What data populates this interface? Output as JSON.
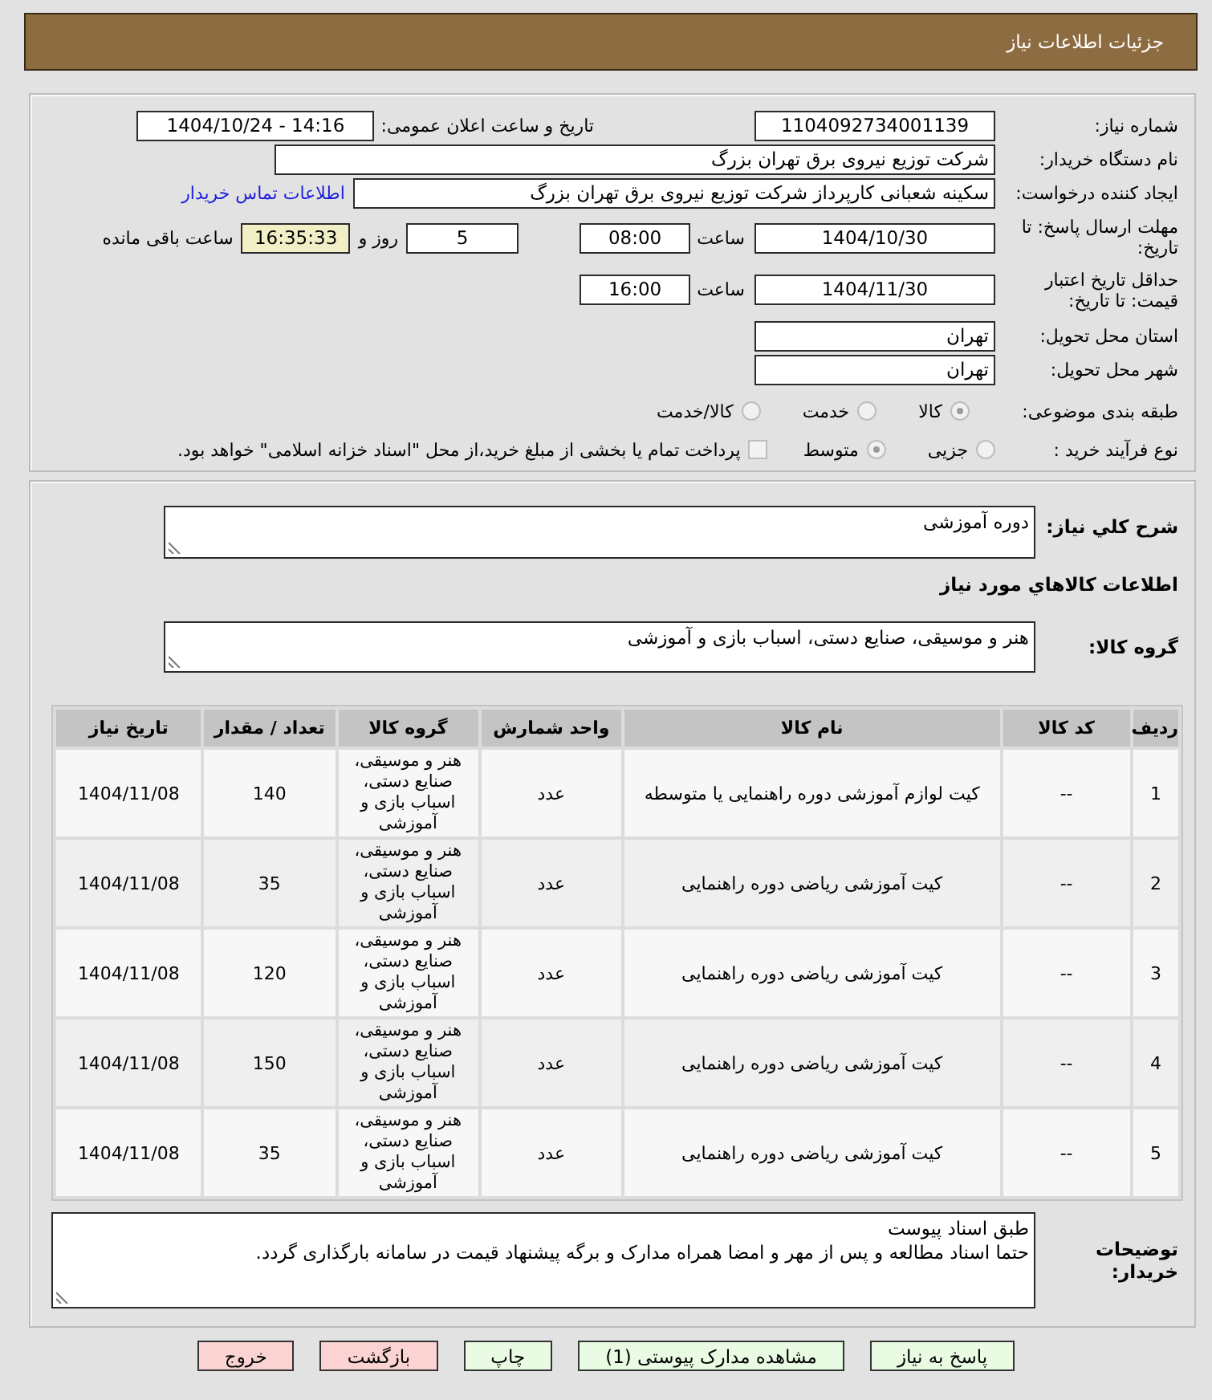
{
  "header": {
    "title": "جزئیات اطلاعات نیاز"
  },
  "details": {
    "need_number": {
      "label": "شماره نیاز:",
      "value": "1104092734001139"
    },
    "announce": {
      "label": "تاریخ و ساعت اعلان عمومی:",
      "value": "1404/10/24 - 14:16"
    },
    "buyer": {
      "label": "نام دستگاه خریدار:",
      "value": "شرکت توزیع نیروی برق تهران بزرگ"
    },
    "creator": {
      "label": "ایجاد کننده درخواست:",
      "value": "سکینه شعبانی کارپرداز شرکت توزیع نیروی برق تهران بزرگ",
      "link": "اطلاعات تماس خریدار"
    },
    "response_deadline": {
      "label": "مهلت ارسال پاسخ: تا تاریخ:",
      "date": "1404/10/30",
      "time_label": "ساعت",
      "time": "08:00",
      "days": "5",
      "days_label": "روز و",
      "remaining": "16:35:33",
      "remaining_label": "ساعت باقی مانده"
    },
    "price_validity": {
      "label": "حداقل تاریخ اعتبار قیمت: تا تاریخ:",
      "date": "1404/11/30",
      "time_label": "ساعت",
      "time": "16:00"
    },
    "province": {
      "label": "استان محل تحویل:",
      "value": "تهران"
    },
    "city": {
      "label": "شهر محل تحویل:",
      "value": "تهران"
    },
    "category": {
      "label": "طبقه بندی موضوعی:",
      "options": [
        {
          "label": "کالا",
          "selected": true
        },
        {
          "label": "خدمت",
          "selected": false
        },
        {
          "label": "کالا/خدمت",
          "selected": false
        }
      ]
    },
    "process": {
      "label": "نوع فرآیند خرید :",
      "options": [
        {
          "label": "جزیی",
          "selected": false
        },
        {
          "label": "متوسط",
          "selected": true
        }
      ],
      "treasury": {
        "label": "پرداخت تمام یا بخشی از مبلغ خرید،از محل \"اسناد خزانه اسلامی\" خواهد بود.",
        "checked": false
      }
    }
  },
  "description": {
    "label": "شرح کلي نیاز:",
    "value": "دوره آموزشی"
  },
  "goods_heading": "اطلاعات کالاهاي مورد نیاز",
  "goods_group": {
    "label": "گروه کالا:",
    "value": "هنر و موسیقی، صنایع دستی، اسباب بازی و آموزشی"
  },
  "table": {
    "columns": [
      "ردیف",
      "کد کالا",
      "نام کالا",
      "واحد شمارش",
      "گروه کالا",
      "تعداد / مقدار",
      "تاریخ نیاز"
    ],
    "rows": [
      [
        "1",
        "--",
        "کیت لوازم آموزشی دوره راهنمایی یا متوسطه",
        "عدد",
        "هنر و موسیقی، صنایع دستی، اسباب بازی و آموزشی",
        "140",
        "1404/11/08"
      ],
      [
        "2",
        "--",
        "کیت آموزشی ریاضی دوره راهنمایی",
        "عدد",
        "هنر و موسیقی، صنایع دستی، اسباب بازی و آموزشی",
        "35",
        "1404/11/08"
      ],
      [
        "3",
        "--",
        "کیت آموزشی ریاضی دوره راهنمایی",
        "عدد",
        "هنر و موسیقی، صنایع دستی، اسباب بازی و آموزشی",
        "120",
        "1404/11/08"
      ],
      [
        "4",
        "--",
        "کیت آموزشی ریاضی دوره راهنمایی",
        "عدد",
        "هنر و موسیقی، صنایع دستی، اسباب بازی و آموزشی",
        "150",
        "1404/11/08"
      ],
      [
        "5",
        "--",
        "کیت آموزشی ریاضی دوره راهنمایی",
        "عدد",
        "هنر و موسیقی، صنایع دستی، اسباب بازی و آموزشی",
        "35",
        "1404/11/08"
      ]
    ]
  },
  "buyer_notes": {
    "label": "توضیحات خریدار:",
    "lines": [
      "طبق اسناد پیوست",
      "حتما اسناد مطالعه و پس از مهر و امضا همراه مدارک و برگه پیشنهاد قیمت در سامانه بارگذاری گردد."
    ]
  },
  "buttons": [
    {
      "label": "پاسخ به نیاز",
      "kind": "action"
    },
    {
      "label": "مشاهده مدارک پیوستی (1)",
      "kind": "action"
    },
    {
      "label": "چاپ",
      "kind": "action"
    },
    {
      "label": "بازگشت",
      "kind": "leave"
    },
    {
      "label": "خروج",
      "kind": "leave"
    }
  ]
}
